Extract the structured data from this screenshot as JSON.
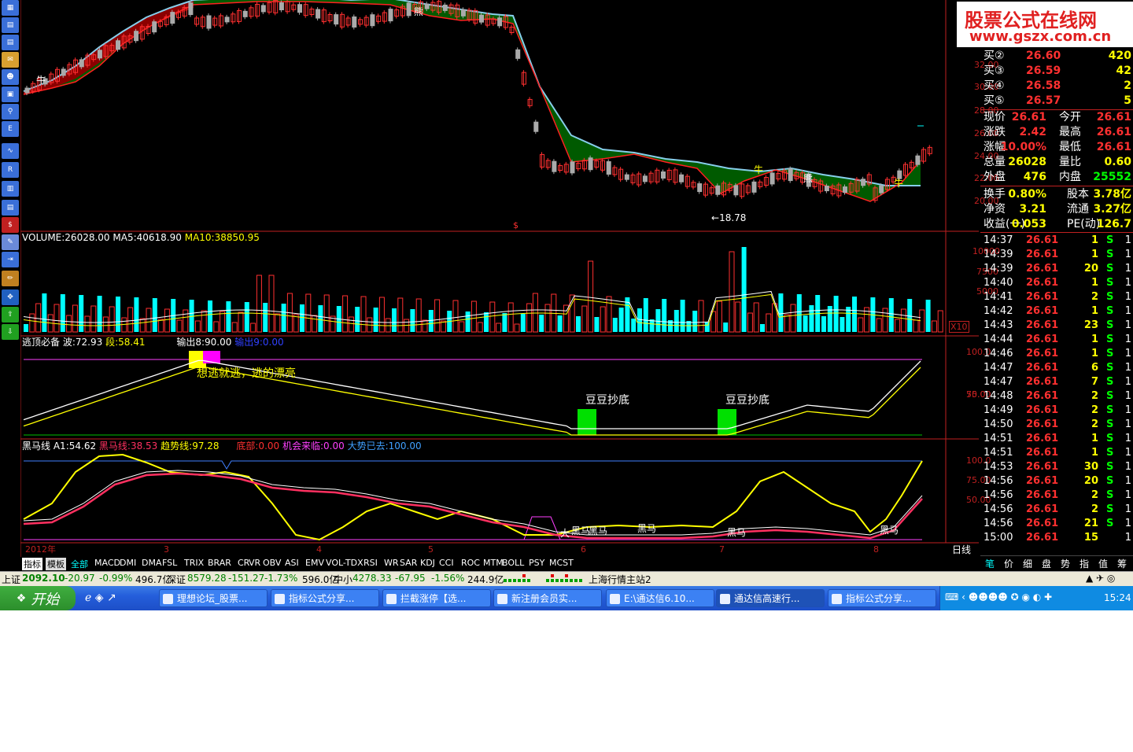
{
  "window": {
    "watermark_title": "股票公式在线网",
    "watermark_url": "www.gszx.com.cn"
  },
  "chart": {
    "price_ticks": [
      "32.00",
      "30.00",
      "28.00",
      "26.00",
      "24.00",
      "22.00",
      "20.00"
    ],
    "price_low_marker": "18.78",
    "signals": {
      "bear": "熊",
      "bull": "牛"
    },
    "vol_header": {
      "label": "VOLUME:26028.00",
      "ma5": "MA5:40618.90",
      "ma10": "MA10:38850.95"
    },
    "vol_ticks": [
      "10000",
      "7500",
      "5000"
    ],
    "vol_unit": "X10",
    "ind1_header": {
      "name": "逃顶必备",
      "bo": "波:72.93",
      "duan": "段:58.41",
      "out1": "输出8:90.00",
      "out2": "输出9:0.00"
    },
    "ind1_ticks": [
      "100.0",
      "75.00",
      "50.00"
    ],
    "ind1_texts": {
      "escape": "想逃就逃，逃的漂亮",
      "bottom1": "豆豆抄底",
      "bottom2": "豆豆抄底"
    },
    "ind2_header": {
      "name": "黑马线",
      "a1": "A1:54.62",
      "hm": "黑马线:38.53",
      "trend": "趋势线:97.28",
      "bottom": "底部:0.00",
      "chance": "机会来临:0.00",
      "gone": "大势已去:100.00"
    },
    "ind2_ticks": [
      "100.0",
      "75.00",
      "50.00"
    ],
    "ind2_texts": {
      "h1": "黑马",
      "h2": "黑马",
      "h3": "黑马",
      "h4": "黑马",
      "h5": "黑马",
      "h6": "黑马",
      "big": "大"
    },
    "xaxis": {
      "year": "2012年",
      "m3": "3",
      "m4": "4",
      "m5": "5",
      "m6": "6",
      "m7": "7",
      "m8": "8",
      "period": "日线"
    }
  },
  "tabs": [
    "指标",
    "模板",
    "全部",
    "MACD",
    "DMI",
    "DMA",
    "FSL",
    "TRIX",
    "BRAR",
    "CR",
    "VR",
    "OBV",
    "ASI",
    "EMV",
    "VOL-TDX",
    "RSI",
    "WR",
    "SAR",
    "KDJ",
    "CCI",
    "ROC",
    "MTM",
    "BOLL",
    "PSY",
    "MCST"
  ],
  "quote": {
    "bids": [
      {
        "label": "买②",
        "price": "26.60",
        "vol": "420"
      },
      {
        "label": "买③",
        "price": "26.59",
        "vol": "42"
      },
      {
        "label": "买④",
        "price": "26.58",
        "vol": "2"
      },
      {
        "label": "买⑤",
        "price": "26.57",
        "vol": "5"
      }
    ],
    "stats": [
      {
        "l1": "现价",
        "v1": "26.61",
        "l2": "今开",
        "v2": "26.61"
      },
      {
        "l1": "涨跌",
        "v1": "2.42",
        "l2": "最高",
        "v2": "26.61"
      },
      {
        "l1": "涨幅",
        "v1": "10.00%",
        "l2": "最低",
        "v2": "26.61"
      },
      {
        "l1": "总量",
        "v1": "26028",
        "l2": "量比",
        "v2": "0.60"
      },
      {
        "l1": "外盘",
        "v1": "476",
        "l2": "内盘",
        "v2": "25552"
      }
    ],
    "stats2": [
      {
        "l1": "换手",
        "v1": "0.80%",
        "l2": "股本",
        "v2": "3.78亿"
      },
      {
        "l1": "净资",
        "v1": "3.21",
        "l2": "流通",
        "v2": "3.27亿"
      },
      {
        "l1": "收益(一)",
        "v1": "0.053",
        "l2": "PE(动)",
        "v2": "126.7"
      }
    ],
    "ticks": [
      {
        "t": "14:37",
        "p": "26.61",
        "v": "1",
        "s": "S",
        "n": "1"
      },
      {
        "t": "14:39",
        "p": "26.61",
        "v": "1",
        "s": "S",
        "n": "1"
      },
      {
        "t": "14:39",
        "p": "26.61",
        "v": "20",
        "s": "S",
        "n": "1"
      },
      {
        "t": "14:40",
        "p": "26.61",
        "v": "1",
        "s": "S",
        "n": "1"
      },
      {
        "t": "14:41",
        "p": "26.61",
        "v": "2",
        "s": "S",
        "n": "1"
      },
      {
        "t": "14:42",
        "p": "26.61",
        "v": "1",
        "s": "S",
        "n": "1"
      },
      {
        "t": "14:43",
        "p": "26.61",
        "v": "23",
        "s": "S",
        "n": "1"
      },
      {
        "t": "14:44",
        "p": "26.61",
        "v": "1",
        "s": "S",
        "n": "1"
      },
      {
        "t": "14:46",
        "p": "26.61",
        "v": "1",
        "s": "S",
        "n": "1"
      },
      {
        "t": "14:47",
        "p": "26.61",
        "v": "6",
        "s": "S",
        "n": "1"
      },
      {
        "t": "14:47",
        "p": "26.61",
        "v": "7",
        "s": "S",
        "n": "1"
      },
      {
        "t": "14:48",
        "p": "26.61",
        "v": "2",
        "s": "S",
        "n": "1"
      },
      {
        "t": "14:49",
        "p": "26.61",
        "v": "2",
        "s": "S",
        "n": "1"
      },
      {
        "t": "14:50",
        "p": "26.61",
        "v": "2",
        "s": "S",
        "n": "1"
      },
      {
        "t": "14:51",
        "p": "26.61",
        "v": "1",
        "s": "S",
        "n": "1"
      },
      {
        "t": "14:51",
        "p": "26.61",
        "v": "1",
        "s": "S",
        "n": "1"
      },
      {
        "t": "14:53",
        "p": "26.61",
        "v": "30",
        "s": "S",
        "n": "1"
      },
      {
        "t": "14:56",
        "p": "26.61",
        "v": "20",
        "s": "S",
        "n": "1"
      },
      {
        "t": "14:56",
        "p": "26.61",
        "v": "2",
        "s": "S",
        "n": "1"
      },
      {
        "t": "14:56",
        "p": "26.61",
        "v": "2",
        "s": "S",
        "n": "1"
      },
      {
        "t": "14:56",
        "p": "26.61",
        "v": "21",
        "s": "S",
        "n": "1"
      },
      {
        "t": "15:00",
        "p": "26.61",
        "v": "15",
        "s": "",
        "n": "1"
      }
    ],
    "bottom_tabs": [
      "笔",
      "价",
      "细",
      "盘",
      "势",
      "指",
      "值",
      "筹"
    ]
  },
  "status": {
    "sh_label": "上证",
    "sh_val": "2092.10",
    "sh_chg": "-20.97",
    "sh_pct": "-0.99%",
    "sh_amt": "496.7亿",
    "sz_label": "深证",
    "sz_val": "8579.28",
    "sz_chg": "-151.27",
    "sz_pct": "-1.73%",
    "sz_amt": "596.0亿",
    "zx_label": "中小",
    "zx_val": "4278.33",
    "zx_chg": "-67.95",
    "zx_pct": "-1.56%",
    "zx_amt": "244.9亿",
    "server": "上海行情主站2"
  },
  "taskbar": {
    "start": "开始",
    "tasks": [
      "理想论坛_股票...",
      "指标公式分享...",
      "拦截涨停【选...",
      "新注册会员实...",
      "E:\\通达信6.10...",
      "通达信高速行...",
      "指标公式分享..."
    ],
    "clock": "15:24"
  }
}
